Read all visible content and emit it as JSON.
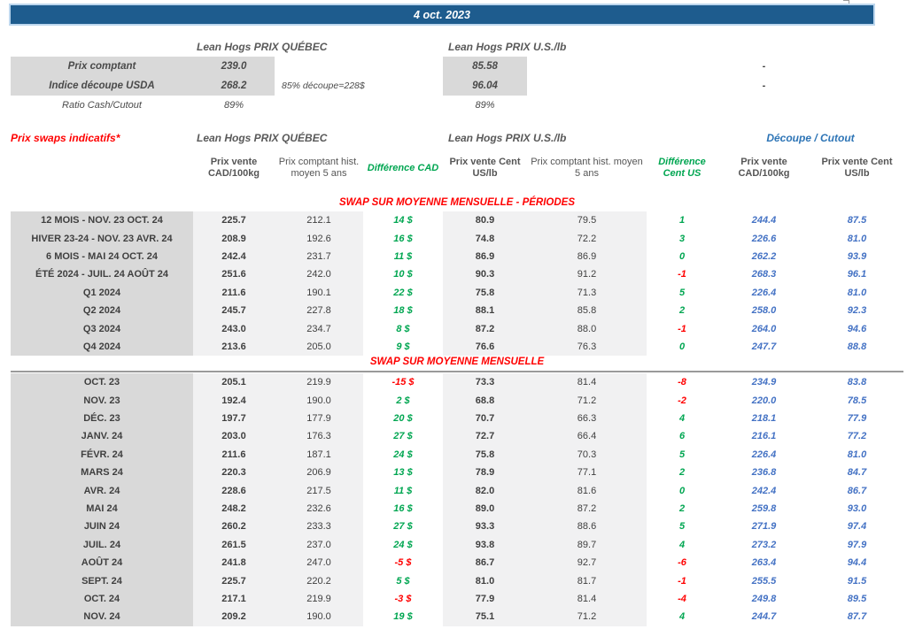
{
  "title_bar": {
    "date": "4 oct. 2023"
  },
  "colors": {
    "header_bar_blue": "#1E5C8E",
    "header_bar_border": "#BDD7EE",
    "cutout_header_blue": "#2E75B6",
    "cutout_value_blue": "#4472C4",
    "positive_green": "#00A651",
    "negative_red": "#FF0000",
    "label_gray": "#D9D9D9",
    "band_gray": "#F1F1F2"
  },
  "spot": {
    "qc_header": "Lean Hogs PRIX QUÉBEC",
    "us_header": "Lean Hogs PRIX U.S./lb",
    "rows": [
      {
        "label": "Prix comptant",
        "qc": "239.0",
        "note": "",
        "us": "85.58",
        "right": "-",
        "shaded": true,
        "bold": true
      },
      {
        "label": "Indice découpe USDA",
        "qc": "268.2",
        "note": "85% découpe=228$",
        "us": "96.04",
        "right": "-",
        "shaded": true,
        "bold": true
      },
      {
        "label": "Ratio Cash/Cutout",
        "qc": "89%",
        "note": "",
        "us": "89%",
        "right": "",
        "shaded": false,
        "bold": false
      }
    ]
  },
  "swaps": {
    "title": "Prix swaps indicatifs*",
    "qc_group": "Lean Hogs PRIX QUÉBEC",
    "us_group": "Lean Hogs PRIX U.S./lb",
    "cutout_group": "Découpe / Cutout",
    "col_headers": [
      "Prix vente CAD/100kg",
      "Prix comptant hist. moyen 5 ans",
      "Différence CAD",
      "Prix vente Cent US/lb",
      "Prix comptant hist. moyen 5 ans",
      "Différence Cent US",
      "Prix vente CAD/100kg",
      "Prix vente Cent US/lb"
    ],
    "sections": [
      {
        "title": "SWAP SUR MOYENNE MENSUELLE - PÉRIODES",
        "divider": false,
        "rows": [
          {
            "label": "12 MOIS - NOV. 23 OCT. 24",
            "cad": "225.7",
            "cad_hist": "212.1",
            "diff_cad": "14 $",
            "us": "80.9",
            "us_hist": "79.5",
            "diff_us": "1",
            "cut_cad": "244.4",
            "cut_us": "87.5"
          },
          {
            "label": "HIVER 23-24 - NOV. 23 AVR. 24",
            "cad": "208.9",
            "cad_hist": "192.6",
            "diff_cad": "16 $",
            "us": "74.8",
            "us_hist": "72.2",
            "diff_us": "3",
            "cut_cad": "226.6",
            "cut_us": "81.0"
          },
          {
            "label": "6 MOIS - MAI 24 OCT. 24",
            "cad": "242.4",
            "cad_hist": "231.7",
            "diff_cad": "11 $",
            "us": "86.9",
            "us_hist": "86.9",
            "diff_us": "0",
            "cut_cad": "262.2",
            "cut_us": "93.9"
          },
          {
            "label": "ÉTÉ 2024 - JUIL. 24 AOÛT 24",
            "cad": "251.6",
            "cad_hist": "242.0",
            "diff_cad": "10 $",
            "us": "90.3",
            "us_hist": "91.2",
            "diff_us": "-1",
            "cut_cad": "268.3",
            "cut_us": "96.1"
          },
          {
            "label": "Q1 2024",
            "cad": "211.6",
            "cad_hist": "190.1",
            "diff_cad": "22 $",
            "us": "75.8",
            "us_hist": "71.3",
            "diff_us": "5",
            "cut_cad": "226.4",
            "cut_us": "81.0"
          },
          {
            "label": "Q2 2024",
            "cad": "245.7",
            "cad_hist": "227.8",
            "diff_cad": "18 $",
            "us": "88.1",
            "us_hist": "85.8",
            "diff_us": "2",
            "cut_cad": "258.0",
            "cut_us": "92.3"
          },
          {
            "label": "Q3 2024",
            "cad": "243.0",
            "cad_hist": "234.7",
            "diff_cad": "8 $",
            "us": "87.2",
            "us_hist": "88.0",
            "diff_us": "-1",
            "cut_cad": "264.0",
            "cut_us": "94.6"
          },
          {
            "label": "Q4 2024",
            "cad": "213.6",
            "cad_hist": "205.0",
            "diff_cad": "9 $",
            "us": "76.6",
            "us_hist": "76.3",
            "diff_us": "0",
            "cut_cad": "247.7",
            "cut_us": "88.8"
          }
        ]
      },
      {
        "title": "SWAP SUR MOYENNE MENSUELLE",
        "divider": true,
        "rows": [
          {
            "label": "OCT. 23",
            "cad": "205.1",
            "cad_hist": "219.9",
            "diff_cad": "-15 $",
            "us": "73.3",
            "us_hist": "81.4",
            "diff_us": "-8",
            "cut_cad": "234.9",
            "cut_us": "83.8"
          },
          {
            "label": "NOV. 23",
            "cad": "192.4",
            "cad_hist": "190.0",
            "diff_cad": "2 $",
            "us": "68.8",
            "us_hist": "71.2",
            "diff_us": "-2",
            "cut_cad": "220.0",
            "cut_us": "78.5"
          },
          {
            "label": "DÉC. 23",
            "cad": "197.7",
            "cad_hist": "177.9",
            "diff_cad": "20 $",
            "us": "70.7",
            "us_hist": "66.3",
            "diff_us": "4",
            "cut_cad": "218.1",
            "cut_us": "77.9"
          },
          {
            "label": "JANV. 24",
            "cad": "203.0",
            "cad_hist": "176.3",
            "diff_cad": "27 $",
            "us": "72.7",
            "us_hist": "66.4",
            "diff_us": "6",
            "cut_cad": "216.1",
            "cut_us": "77.2"
          },
          {
            "label": "FÉVR. 24",
            "cad": "211.6",
            "cad_hist": "187.1",
            "diff_cad": "24 $",
            "us": "75.8",
            "us_hist": "70.3",
            "diff_us": "5",
            "cut_cad": "226.4",
            "cut_us": "81.0"
          },
          {
            "label": "MARS 24",
            "cad": "220.3",
            "cad_hist": "206.9",
            "diff_cad": "13 $",
            "us": "78.9",
            "us_hist": "77.1",
            "diff_us": "2",
            "cut_cad": "236.8",
            "cut_us": "84.7"
          },
          {
            "label": "AVR. 24",
            "cad": "228.6",
            "cad_hist": "217.5",
            "diff_cad": "11 $",
            "us": "82.0",
            "us_hist": "81.6",
            "diff_us": "0",
            "cut_cad": "242.4",
            "cut_us": "86.7"
          },
          {
            "label": "MAI 24",
            "cad": "248.2",
            "cad_hist": "232.6",
            "diff_cad": "16 $",
            "us": "89.0",
            "us_hist": "87.2",
            "diff_us": "2",
            "cut_cad": "259.8",
            "cut_us": "93.0"
          },
          {
            "label": "JUIN 24",
            "cad": "260.2",
            "cad_hist": "233.3",
            "diff_cad": "27 $",
            "us": "93.3",
            "us_hist": "88.6",
            "diff_us": "5",
            "cut_cad": "271.9",
            "cut_us": "97.4"
          },
          {
            "label": "JUIL. 24",
            "cad": "261.5",
            "cad_hist": "237.0",
            "diff_cad": "24 $",
            "us": "93.8",
            "us_hist": "89.7",
            "diff_us": "4",
            "cut_cad": "273.2",
            "cut_us": "97.9"
          },
          {
            "label": "AOÛT 24",
            "cad": "241.8",
            "cad_hist": "247.0",
            "diff_cad": "-5 $",
            "us": "86.7",
            "us_hist": "92.7",
            "diff_us": "-6",
            "cut_cad": "263.4",
            "cut_us": "94.4"
          },
          {
            "label": "SEPT. 24",
            "cad": "225.7",
            "cad_hist": "220.2",
            "diff_cad": "5 $",
            "us": "81.0",
            "us_hist": "81.7",
            "diff_us": "-1",
            "cut_cad": "255.5",
            "cut_us": "91.5"
          },
          {
            "label": "OCT. 24",
            "cad": "217.1",
            "cad_hist": "219.9",
            "diff_cad": "-3 $",
            "us": "77.9",
            "us_hist": "81.4",
            "diff_us": "-4",
            "cut_cad": "249.8",
            "cut_us": "89.5"
          },
          {
            "label": "NOV. 24",
            "cad": "209.2",
            "cad_hist": "190.0",
            "diff_cad": "19 $",
            "us": "75.1",
            "us_hist": "71.2",
            "diff_us": "4",
            "cut_cad": "244.7",
            "cut_us": "87.7"
          }
        ]
      }
    ]
  }
}
